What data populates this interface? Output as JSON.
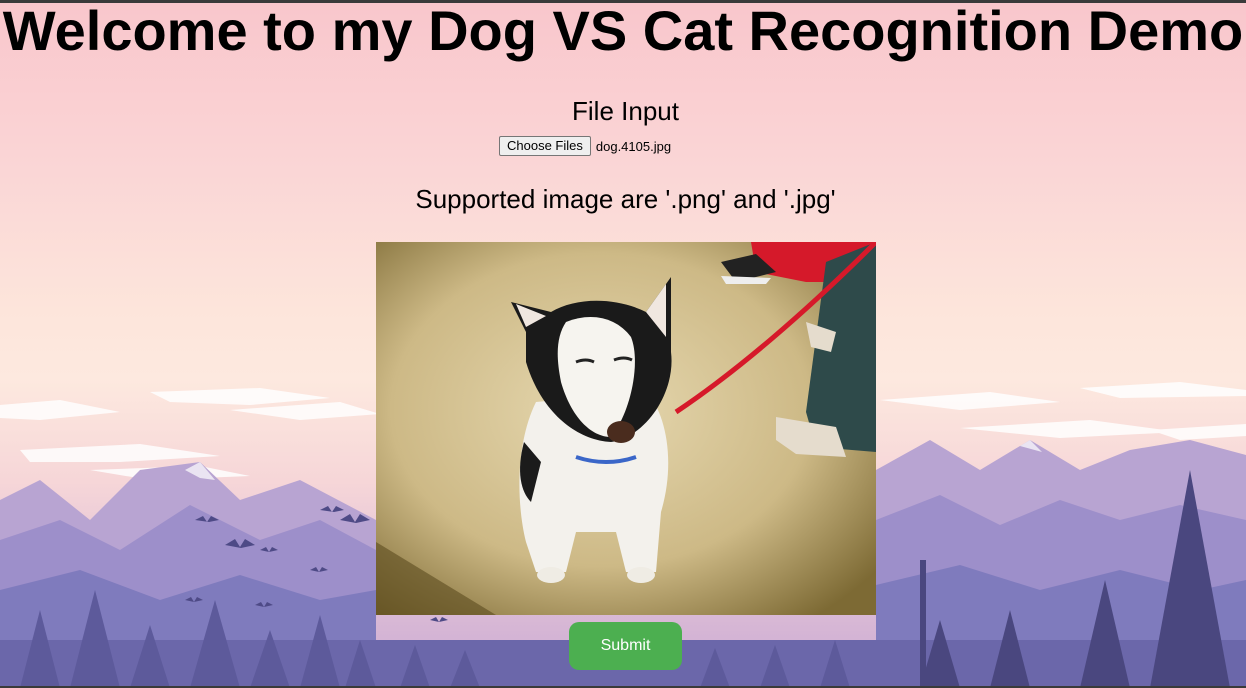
{
  "page": {
    "title": "Welcome to my Dog VS Cat Recognition Demo"
  },
  "upload": {
    "heading": "File Input",
    "choose_label": "Choose Files",
    "file_name": "dog.4105.jpg",
    "supported_text": "Supported image are '.png' and '.jpg'"
  },
  "preview": {
    "description": "dog-photo"
  },
  "actions": {
    "submit_label": "Submit"
  },
  "colors": {
    "submit_bg": "#4caf50",
    "sky_top": "#f9c6cc",
    "mountain": "#8f86c4"
  }
}
